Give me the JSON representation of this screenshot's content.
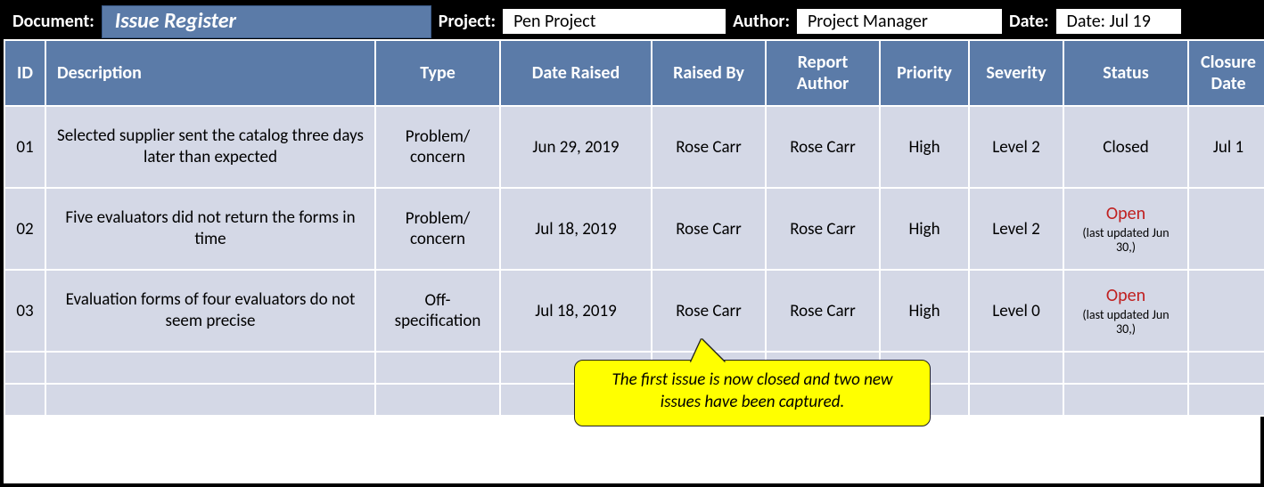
{
  "meta": {
    "document_label": "Document:",
    "document_value": "Issue Register",
    "project_label": "Project:",
    "project_value": "Pen Project",
    "author_label": "Author:",
    "author_value": "Project Manager",
    "date_label": "Date:",
    "date_value": "Date: Jul 19"
  },
  "headers": {
    "id": "ID",
    "description": "Description",
    "type": "Type",
    "date_raised": "Date Raised",
    "raised_by": "Raised By",
    "report_author": "Report Author",
    "priority": "Priority",
    "severity": "Severity",
    "status": "Status",
    "closure_date": "Closure Date"
  },
  "rows": [
    {
      "id": "01",
      "description": "Selected supplier sent the catalog three days later than expected",
      "type": "Problem/ concern",
      "date_raised": "Jun 29, 2019",
      "raised_by": "Rose Carr",
      "report_author": "Rose Carr",
      "priority": "High",
      "severity": "Level 2",
      "status": "Closed",
      "status_note": "",
      "closure_date": "Jul 1"
    },
    {
      "id": "02",
      "description": "Five evaluators did not return the forms in time",
      "type": "Problem/ concern",
      "date_raised": "Jul 18, 2019",
      "raised_by": "Rose Carr",
      "report_author": "Rose Carr",
      "priority": "High",
      "severity": "Level 2",
      "status": "Open",
      "status_note": "(last updated Jun 30,)",
      "closure_date": ""
    },
    {
      "id": "03",
      "description": "Evaluation forms of four evaluators do not seem precise",
      "type": "Off-specification",
      "date_raised": "Jul 18, 2019",
      "raised_by": "Rose Carr",
      "report_author": "Rose Carr",
      "priority": "High",
      "severity": "Level 0",
      "status": "Open",
      "status_note": "(last updated Jun 30,)",
      "closure_date": ""
    }
  ],
  "callout": {
    "text": "The first issue is now closed and two new issues have been captured."
  }
}
